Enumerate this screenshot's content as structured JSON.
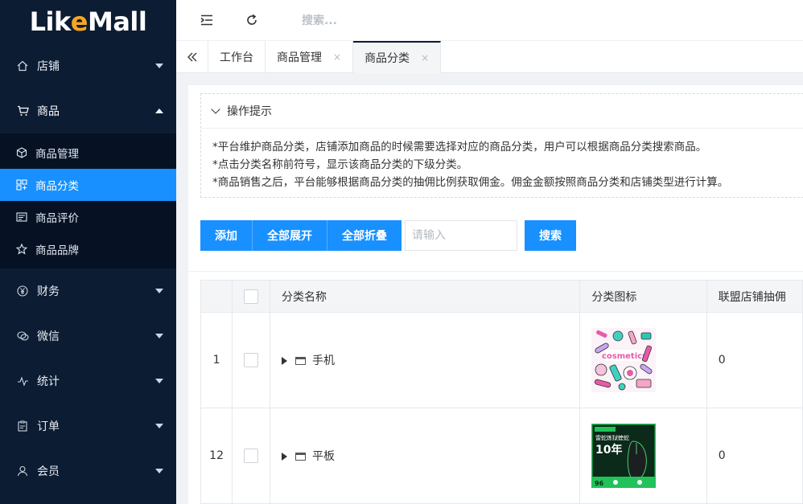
{
  "logo": {
    "part1": "Lik",
    "part2": "e",
    "part3": "Mall"
  },
  "sidebar": {
    "items": [
      {
        "label": "店铺",
        "icon": "home-icon"
      },
      {
        "label": "商品",
        "icon": "cart-icon",
        "open": true,
        "children": [
          {
            "label": "商品管理",
            "icon": "cube-icon"
          },
          {
            "label": "商品分类",
            "icon": "grid-icon",
            "active": true
          },
          {
            "label": "商品评价",
            "icon": "comment-icon"
          },
          {
            "label": "商品品牌",
            "icon": "star-icon"
          }
        ]
      },
      {
        "label": "财务",
        "icon": "yen-icon"
      },
      {
        "label": "微信",
        "icon": "wechat-icon"
      },
      {
        "label": "统计",
        "icon": "pulse-icon"
      },
      {
        "label": "订单",
        "icon": "clipboard-icon"
      },
      {
        "label": "会员",
        "icon": "user-icon"
      }
    ]
  },
  "topbar": {
    "search_placeholder": "搜索..."
  },
  "tabs": [
    {
      "label": "工作台"
    },
    {
      "label": "商品管理",
      "close": "×"
    },
    {
      "label": "商品分类",
      "close": "×",
      "active": true
    }
  ],
  "tips": {
    "title": "操作提示",
    "lines": [
      "*平台维护商品分类，店铺添加商品的时候需要选择对应的商品分类，用户可以根据商品分类搜索商品。",
      "*点击分类名称前符号，显示该商品分类的下级分类。",
      "*商品销售之后，平台能够根据商品分类的抽佣比例获取佣金。佣金金额按照商品分类和店铺类型进行计算。"
    ]
  },
  "toolbar": {
    "add": "添加",
    "expand_all": "全部展开",
    "collapse_all": "全部折叠",
    "input_placeholder": "请输入",
    "search": "搜索"
  },
  "table": {
    "headers": {
      "name": "分类名称",
      "icon": "分类图标",
      "commission": "联盟店铺抽佣"
    },
    "rows": [
      {
        "index": "1",
        "name": "手机",
        "commission": "0",
        "image": "cosmetics-thumbnail"
      },
      {
        "index": "12",
        "name": "平板",
        "commission": "0",
        "image": "mouse-thumbnail",
        "image_text": "雷蛇炼狱蝰蛇",
        "image_big": "10年",
        "image_small": "96"
      }
    ]
  },
  "colors": {
    "sidebar_bg": "#0c1c33",
    "accent": "#1890ff",
    "logo_e": "#f5a623"
  }
}
